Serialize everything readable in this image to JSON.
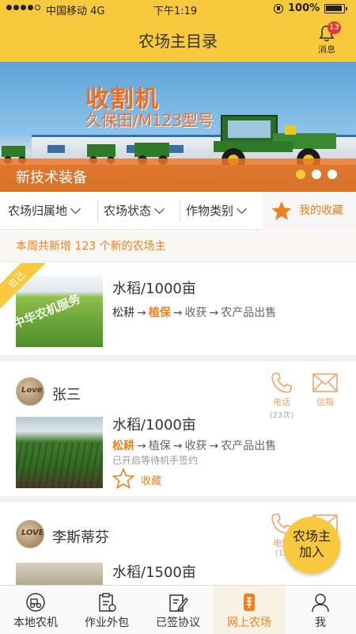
{
  "status_bar": {
    "carrier": "中国移动 4G",
    "time": "下午1:19",
    "battery": "100%"
  },
  "header": {
    "title": "农场主目录",
    "messages_label": "消息",
    "messages_badge": "13"
  },
  "banner": {
    "heading": "收割机",
    "subheading": "久保田/M123型号",
    "caption": "新技术装备",
    "dots": 3,
    "active_dot": 0
  },
  "filters": {
    "items": [
      {
        "label": "农场归属地"
      },
      {
        "label": "农场状态"
      },
      {
        "label": "作物类别"
      }
    ],
    "favorites_label": "我的收藏"
  },
  "notice": "本周共新增 123 个新的农场主",
  "cards": [
    {
      "ribbon": "自己",
      "watermark": "中华农机服务",
      "crop": "水稻/1000亩",
      "steps": [
        "松耕",
        "植保",
        "收获",
        "农产品出售"
      ]
    },
    {
      "name": "张三",
      "avatar_text": "Love",
      "phone_label": "电话",
      "phone_count": "(23次)",
      "mail_label": "信箱",
      "crop": "水稻/1000亩",
      "steps": [
        "松耕",
        "植保",
        "收获",
        "农产品出售"
      ],
      "note": "已开启等待机手签约",
      "collect_label": "收藏"
    },
    {
      "name": "李斯蒂芬",
      "avatar_text": "LOVE",
      "phone_label": "电话",
      "phone_count": "(13",
      "crop": "水稻/1500亩"
    }
  ],
  "join_button": {
    "line1": "农场主",
    "line2": "加入"
  },
  "tabbar": {
    "tabs": [
      {
        "label": "本地农机",
        "icon": "tractor-icon"
      },
      {
        "label": "作业外包",
        "icon": "clipboard-icon"
      },
      {
        "label": "已签协议",
        "icon": "edit-document-icon"
      },
      {
        "label": "网上农场",
        "icon": "wheat-icon"
      },
      {
        "label": "我",
        "icon": "person-icon"
      }
    ],
    "active_index": 3
  },
  "colors": {
    "brand_yellow": "#f8c93c",
    "accent_orange": "#f07f1e",
    "badge_red": "#e8382b"
  }
}
